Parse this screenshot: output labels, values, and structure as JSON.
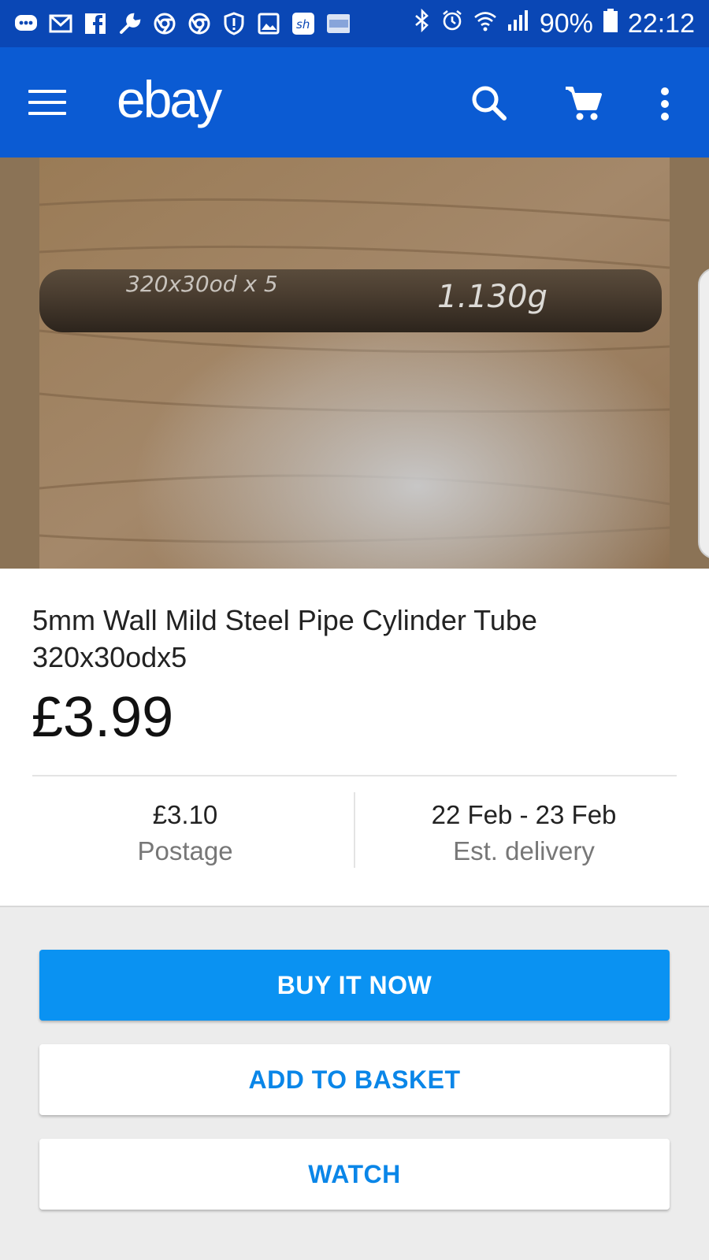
{
  "status_bar": {
    "battery": "90%",
    "time": "22:12",
    "notification_icons": [
      "chat-icon",
      "mail-icon",
      "facebook-icon",
      "wrench-icon",
      "chrome-icon",
      "chrome-icon",
      "shield-icon",
      "image-icon",
      "shpock-icon",
      "ebay-app-icon"
    ]
  },
  "app_bar": {
    "logo": "ebay",
    "background_color": "#0b5bd3"
  },
  "listing": {
    "photo_annotations": [
      "320x30od x 5",
      "1.130g"
    ],
    "title": "5mm Wall Mild Steel Pipe Cylinder Tube 320x30odx5",
    "price": "£3.99",
    "postage_value": "£3.10",
    "postage_label": "Postage",
    "delivery_value": "22 Feb - 23 Feb",
    "delivery_label": "Est. delivery"
  },
  "actions": {
    "buy_now": "BUY IT NOW",
    "add_to_basket": "ADD TO BASKET",
    "watch": "WATCH"
  },
  "colors": {
    "status_bar": "#0a47b5",
    "primary_button": "#0a92f2",
    "secondary_text": "#0a86e8"
  }
}
